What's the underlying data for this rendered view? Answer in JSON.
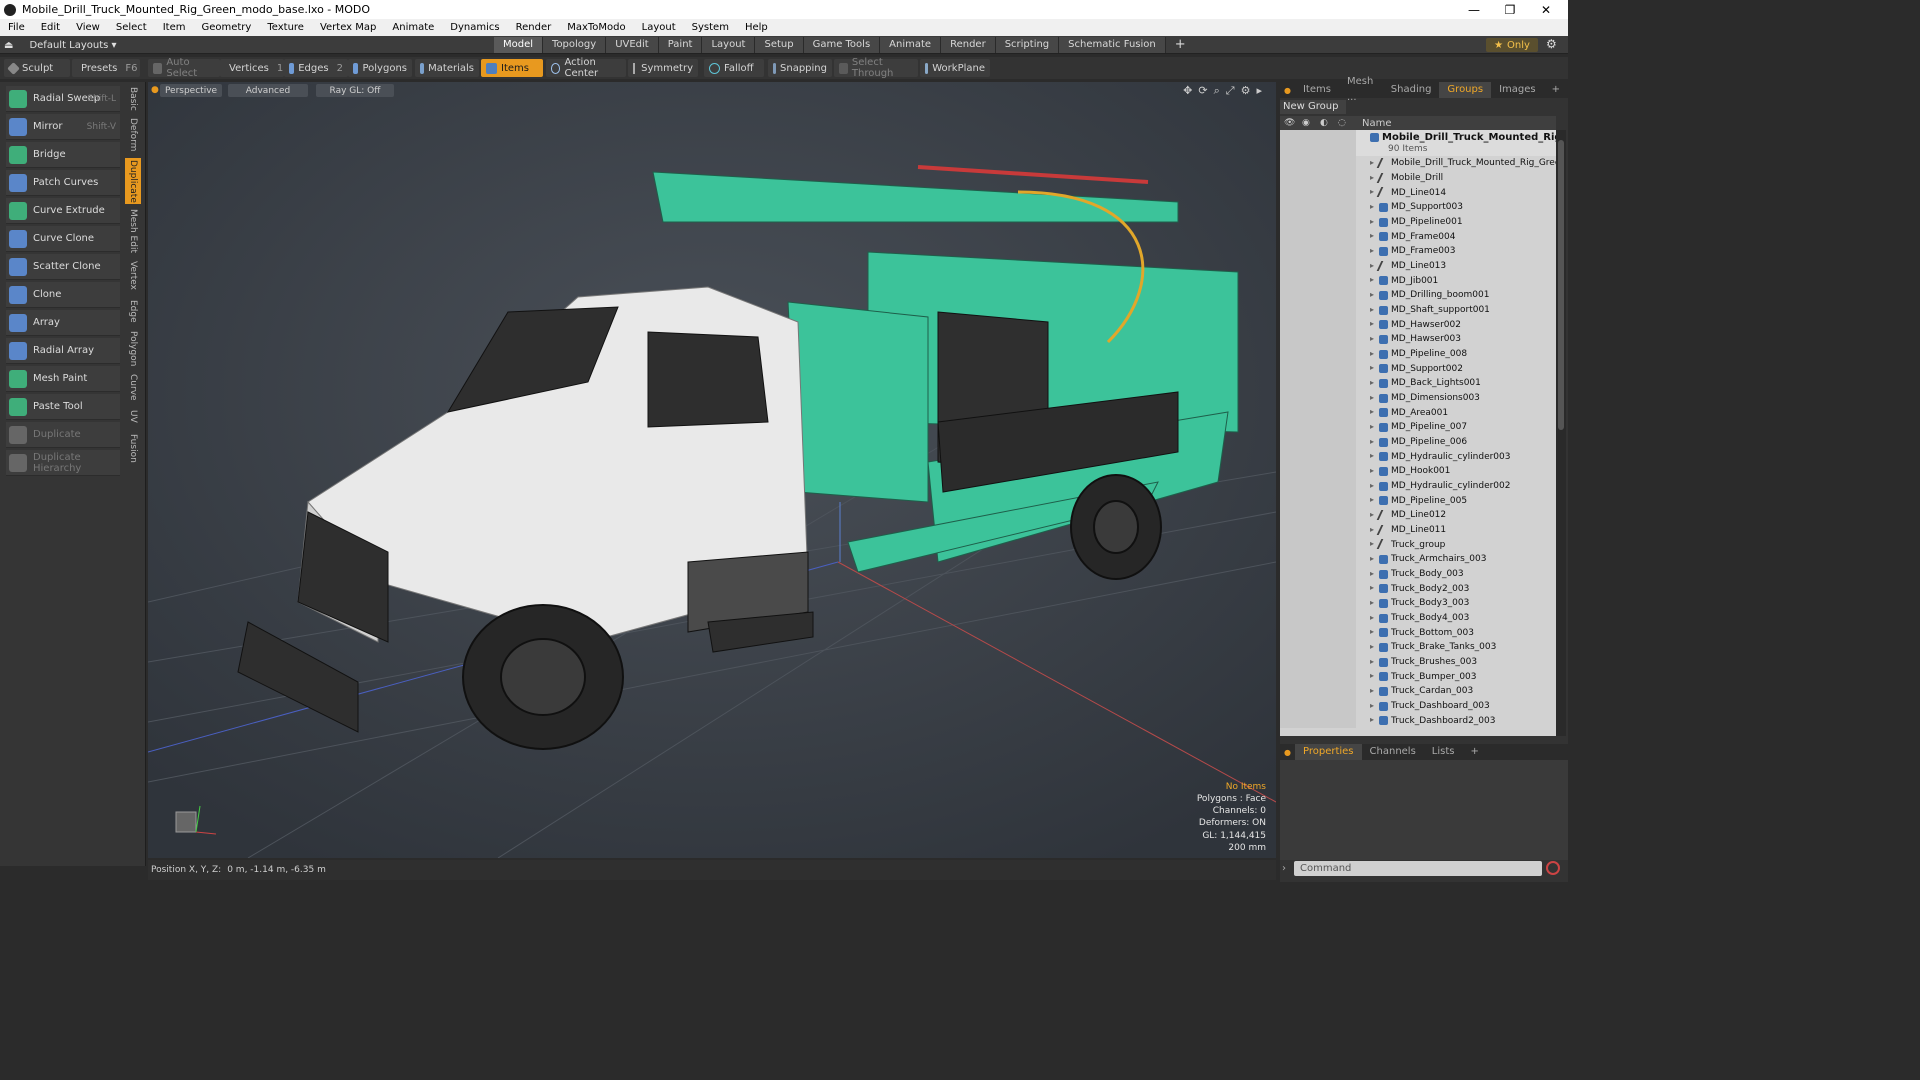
{
  "window": {
    "title": "Mobile_Drill_Truck_Mounted_Rig_Green_modo_base.lxo - MODO",
    "minimize": "—",
    "maximize": "❐",
    "close": "✕"
  },
  "menu": [
    "File",
    "Edit",
    "View",
    "Select",
    "Item",
    "Geometry",
    "Texture",
    "Vertex Map",
    "Animate",
    "Dynamics",
    "Render",
    "MaxToModo",
    "Layout",
    "System",
    "Help"
  ],
  "modebar": {
    "layout": "Default Layouts ▾",
    "tabs": [
      "Model",
      "Topology",
      "UVEdit",
      "Paint",
      "Layout",
      "Setup",
      "Game Tools",
      "Animate",
      "Render",
      "Scripting",
      "Schematic Fusion"
    ],
    "active_tab": "Model",
    "plus": "+",
    "only": "Only",
    "star": "★",
    "gear": "⚙"
  },
  "toolbar": {
    "sculpt": "Sculpt",
    "presets": "Presets",
    "presets_key": "F6",
    "auto_select": "Auto Select",
    "vertices": "Vertices",
    "vertices_count": "1",
    "edges": "Edges",
    "edges_count": "2",
    "polygons": "Polygons",
    "materials": "Materials",
    "items": "Items",
    "action_center": "Action Center",
    "symmetry": "Symmetry",
    "falloff": "Falloff",
    "snapping": "Snapping",
    "select_through": "Select Through",
    "workplane": "WorkPlane"
  },
  "tools": [
    {
      "label": "Radial Sweep",
      "shortcut": "Shift-L",
      "color": "#3fae7a",
      "disabled": false
    },
    {
      "label": "Mirror",
      "shortcut": "Shift-V",
      "color": "#5a86c9",
      "disabled": false
    },
    {
      "label": "Bridge",
      "shortcut": "",
      "color": "#3fae7a",
      "disabled": false
    },
    {
      "label": "Patch Curves",
      "shortcut": "",
      "color": "#5a86c9",
      "disabled": false
    },
    {
      "label": "Curve Extrude",
      "shortcut": "",
      "color": "#3fae7a",
      "disabled": false
    },
    {
      "label": "Curve Clone",
      "shortcut": "",
      "color": "#5a86c9",
      "disabled": false
    },
    {
      "label": "Scatter Clone",
      "shortcut": "",
      "color": "#5a86c9",
      "disabled": false
    },
    {
      "label": "Clone",
      "shortcut": "",
      "color": "#5a86c9",
      "disabled": false
    },
    {
      "label": "Array",
      "shortcut": "",
      "color": "#5a86c9",
      "disabled": false
    },
    {
      "label": "Radial Array",
      "shortcut": "",
      "color": "#5a86c9",
      "disabled": false
    },
    {
      "label": "Mesh Paint",
      "shortcut": "",
      "color": "#3fae7a",
      "disabled": false
    },
    {
      "label": "Paste Tool",
      "shortcut": "",
      "color": "#3fae7a",
      "disabled": false
    },
    {
      "label": "Duplicate",
      "shortcut": "",
      "color": "#666666",
      "disabled": true
    },
    {
      "label": "Duplicate Hierarchy",
      "shortcut": "",
      "color": "#666666",
      "disabled": true
    }
  ],
  "vtabs": [
    "Basic",
    "Deform",
    "Duplicate",
    "Mesh Edit",
    "Vertex",
    "Edge",
    "Polygon",
    "Curve",
    "UV",
    "Fusion"
  ],
  "active_vtab": "Duplicate",
  "viewport": {
    "view": "Perspective",
    "shading": "Advanced",
    "raygl": "Ray GL: Off",
    "stats": {
      "no_items": "No Items",
      "polygons": "Polygons : Face",
      "channels": "Channels: 0",
      "deformers": "Deformers: ON",
      "gl": "GL: 1,144,415",
      "scale": "200 mm"
    },
    "axis_y": "Y",
    "axis_x": "X"
  },
  "status": {
    "label": "Position X, Y, Z:",
    "value": "0 m, -1.14 m, -6.35 m"
  },
  "right_tabs": [
    "Items",
    "Mesh ...",
    "Shading",
    "Groups",
    "Images"
  ],
  "right_active": "Groups",
  "right_plus": "+",
  "new_group": "New Group",
  "list_header": "Name",
  "group": {
    "name": "Mobile_Drill_Truck_Mounted_Rig_...",
    "count": "90 Items"
  },
  "items": [
    {
      "name": "Mobile_Drill_Truck_Mounted_Rig_Green",
      "type": "loc"
    },
    {
      "name": "Mobile_Drill",
      "type": "loc"
    },
    {
      "name": "MD_Line014",
      "type": "loc"
    },
    {
      "name": "MD_Support003",
      "type": "mesh"
    },
    {
      "name": "MD_Pipeline001",
      "type": "mesh"
    },
    {
      "name": "MD_Frame004",
      "type": "mesh"
    },
    {
      "name": "MD_Frame003",
      "type": "mesh"
    },
    {
      "name": "MD_Line013",
      "type": "loc"
    },
    {
      "name": "MD_Jib001",
      "type": "mesh"
    },
    {
      "name": "MD_Drilling_boom001",
      "type": "mesh"
    },
    {
      "name": "MD_Shaft_support001",
      "type": "mesh"
    },
    {
      "name": "MD_Hawser002",
      "type": "mesh"
    },
    {
      "name": "MD_Hawser003",
      "type": "mesh"
    },
    {
      "name": "MD_Pipeline_008",
      "type": "mesh"
    },
    {
      "name": "MD_Support002",
      "type": "mesh"
    },
    {
      "name": "MD_Back_Lights001",
      "type": "mesh"
    },
    {
      "name": "MD_Dimensions003",
      "type": "mesh"
    },
    {
      "name": "MD_Area001",
      "type": "mesh"
    },
    {
      "name": "MD_Pipeline_007",
      "type": "mesh"
    },
    {
      "name": "MD_Pipeline_006",
      "type": "mesh"
    },
    {
      "name": "MD_Hydraulic_cylinder003",
      "type": "mesh"
    },
    {
      "name": "MD_Hook001",
      "type": "mesh"
    },
    {
      "name": "MD_Hydraulic_cylinder002",
      "type": "mesh"
    },
    {
      "name": "MD_Pipeline_005",
      "type": "mesh"
    },
    {
      "name": "MD_Line012",
      "type": "loc"
    },
    {
      "name": "MD_Line011",
      "type": "loc"
    },
    {
      "name": "Truck_group",
      "type": "loc"
    },
    {
      "name": "Truck_Armchairs_003",
      "type": "mesh"
    },
    {
      "name": "Truck_Body_003",
      "type": "mesh"
    },
    {
      "name": "Truck_Body2_003",
      "type": "mesh"
    },
    {
      "name": "Truck_Body3_003",
      "type": "mesh"
    },
    {
      "name": "Truck_Body4_003",
      "type": "mesh"
    },
    {
      "name": "Truck_Bottom_003",
      "type": "mesh"
    },
    {
      "name": "Truck_Brake_Tanks_003",
      "type": "mesh"
    },
    {
      "name": "Truck_Brushes_003",
      "type": "mesh"
    },
    {
      "name": "Truck_Bumper_003",
      "type": "mesh"
    },
    {
      "name": "Truck_Cardan_003",
      "type": "mesh"
    },
    {
      "name": "Truck_Dashboard_003",
      "type": "mesh"
    },
    {
      "name": "Truck_Dashboard2_003",
      "type": "mesh"
    }
  ],
  "prop_tabs": [
    "Properties",
    "Channels",
    "Lists"
  ],
  "prop_active": "Properties",
  "prop_plus": "+",
  "command_placeholder": "Command",
  "colors": {
    "accent": "#e8991f",
    "truck_green": "#3cc39a",
    "viewport_bg": "#3a4048"
  }
}
